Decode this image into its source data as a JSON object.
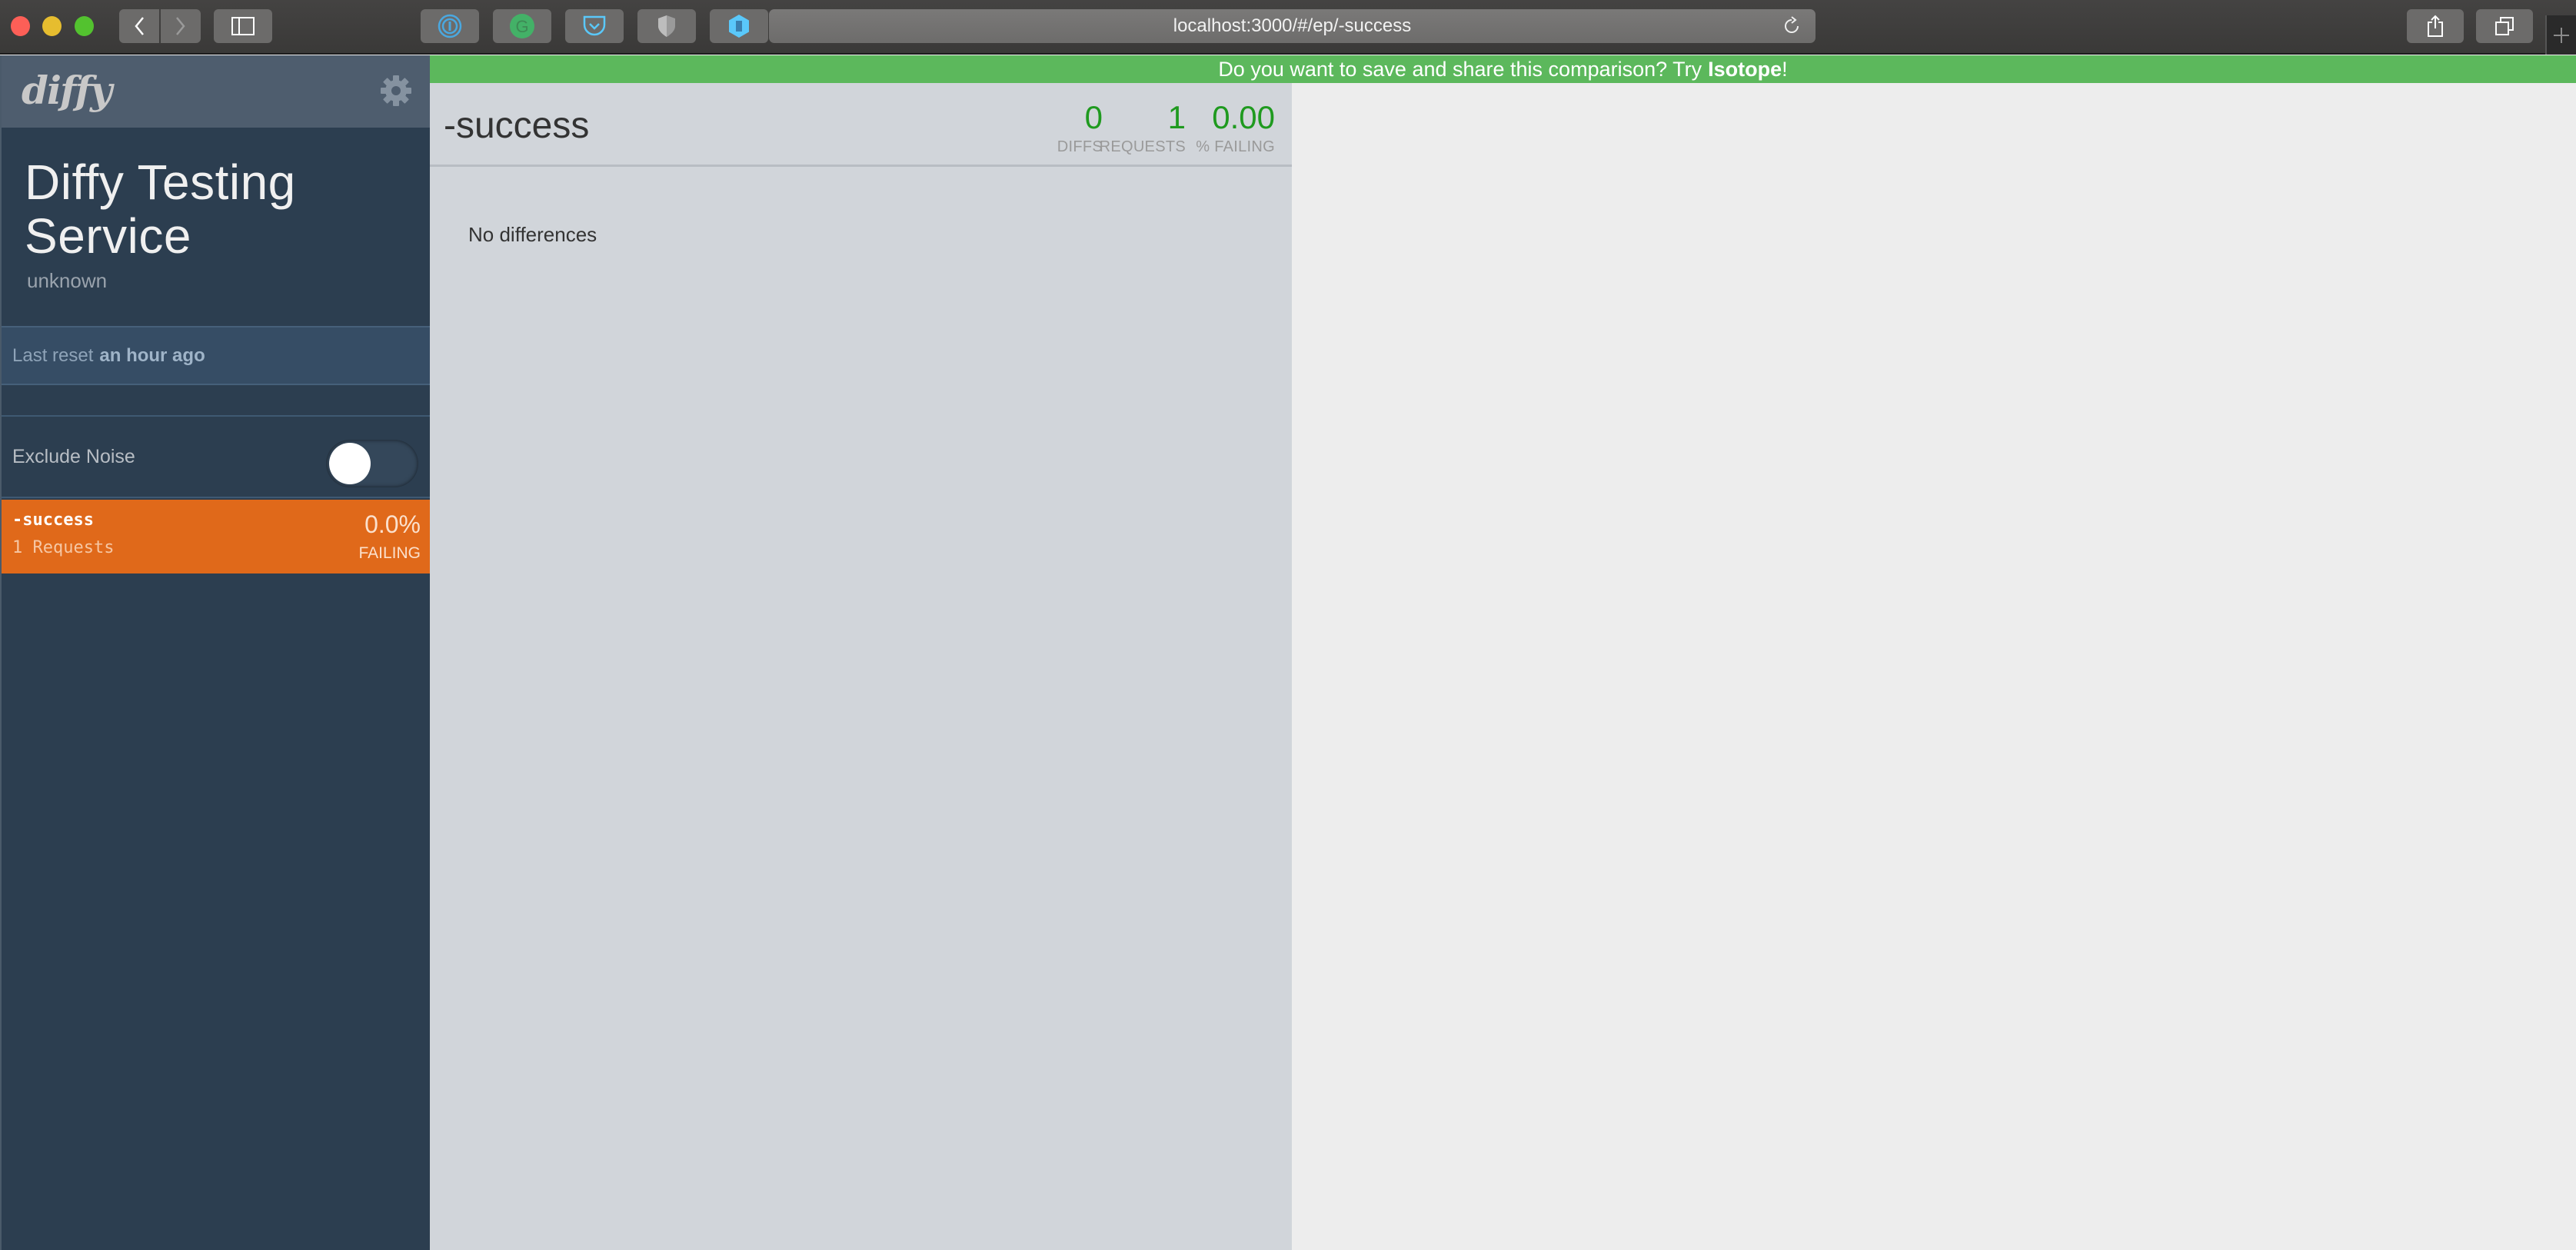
{
  "browser": {
    "url": "localhost:3000/#/ep/-success",
    "extensions": [
      "1password-icon",
      "grammarly-icon",
      "pocket-icon",
      "shield-icon",
      "hexagon-extension-icon"
    ],
    "buttons": {
      "back": "chevron-left-icon",
      "forward": "chevron-right-icon",
      "sidebar": "sidebar-icon",
      "reload": "reload-icon",
      "share": "share-icon",
      "tabs": "tabs-overview-icon",
      "new_tab": "plus-icon"
    }
  },
  "banner": {
    "text": "Do you want to save and share this comparison? Try",
    "link": "Isotope",
    "suffix": "!",
    "color": "#5cb85c"
  },
  "sidebar": {
    "logo": "diffy",
    "settings_icon": "gear-icon",
    "service_title": "Diffy Testing Service",
    "service_subtitle": "unknown",
    "last_reset_label": "Last reset",
    "last_reset_value": "an hour ago",
    "exclude_noise_label": "Exclude Noise",
    "exclude_noise_on": false,
    "endpoints": [
      {
        "name": "-success",
        "requests": "1 Requests",
        "failing_pct": "0.0%",
        "failing_label": "FAILING",
        "selected": true,
        "color": "#e0691a"
      }
    ]
  },
  "main": {
    "endpoint_title": "-success",
    "stats": [
      {
        "value": "0",
        "label": "DIFFS"
      },
      {
        "value": "1",
        "label": "REQUESTS"
      },
      {
        "value": "0.00",
        "label": "% FAILING"
      }
    ],
    "stat_color": "#1f9a1f",
    "empty_message": "No differences"
  }
}
